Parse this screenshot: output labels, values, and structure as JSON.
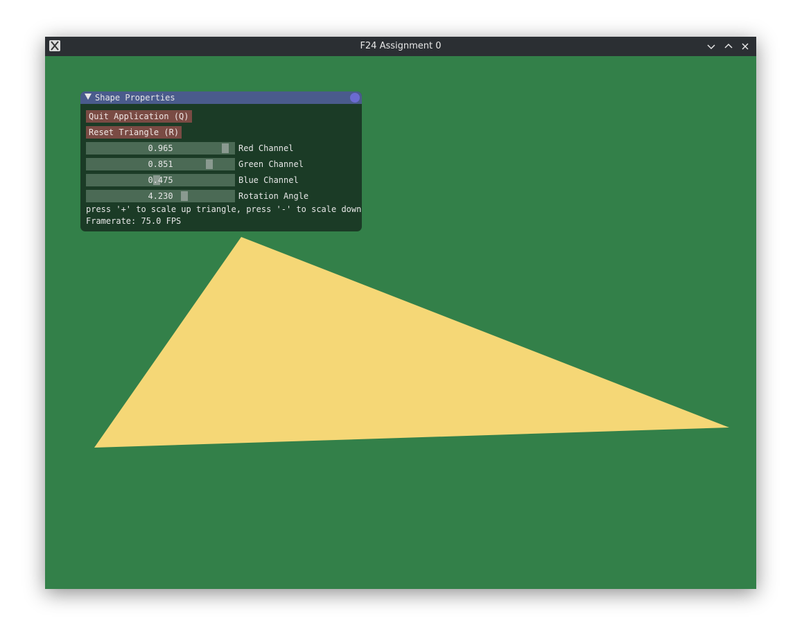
{
  "window": {
    "title": "F24 Assignment 0",
    "icons": [
      "app-icon",
      "minimize-icon",
      "maximize-icon",
      "close-icon"
    ]
  },
  "scene": {
    "background_color": "#338049",
    "triangle_color": "#f5d776"
  },
  "panel": {
    "title": "Shape Properties",
    "quit_label": "Quit Application (Q)",
    "reset_label": "Reset Triangle (R)",
    "sliders": [
      {
        "value": "0.965",
        "label": "Red Channel",
        "fraction": 0.965
      },
      {
        "value": "0.851",
        "label": "Green Channel",
        "fraction": 0.851
      },
      {
        "value": "0.475",
        "label": "Blue Channel",
        "fraction": 0.475
      },
      {
        "value": "4.230",
        "label": "Rotation Angle",
        "fraction": 0.673
      }
    ],
    "hint": "press '+' to scale up triangle, press '-' to scale down",
    "framerate": "Framerate: 75.0 FPS"
  }
}
